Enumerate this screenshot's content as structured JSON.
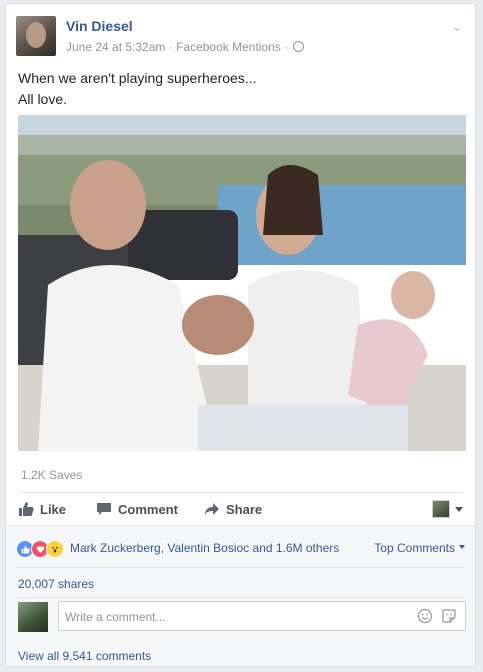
{
  "post": {
    "author": "Vin Diesel",
    "date": "June 24 at 5:32am",
    "separator1": " · ",
    "via": "Facebook Mentions",
    "separator2": " · ",
    "text_line1": "When we aren't playing superheroes...",
    "text_line2": "All love."
  },
  "stats": {
    "saves": "1.2K Saves"
  },
  "actions": {
    "like": "Like",
    "comment": "Comment",
    "share": "Share"
  },
  "reactions": {
    "icons": [
      "like-reaction-icon",
      "love-reaction-icon",
      "wow-reaction-icon"
    ],
    "summary": "Mark Zuckerberg, Valentin Bosioc and 1.6M others",
    "top_comments": "Top Comments"
  },
  "shares": "20,007 shares",
  "comment_box": {
    "placeholder": "Write a comment..."
  },
  "view_all": "View all 9,541 comments",
  "colors": {
    "link": "#365899",
    "like_blue": "#5890ff",
    "love_red": "#f25268",
    "wow_yellow": "#fcd13c",
    "muted": "#90949c"
  }
}
